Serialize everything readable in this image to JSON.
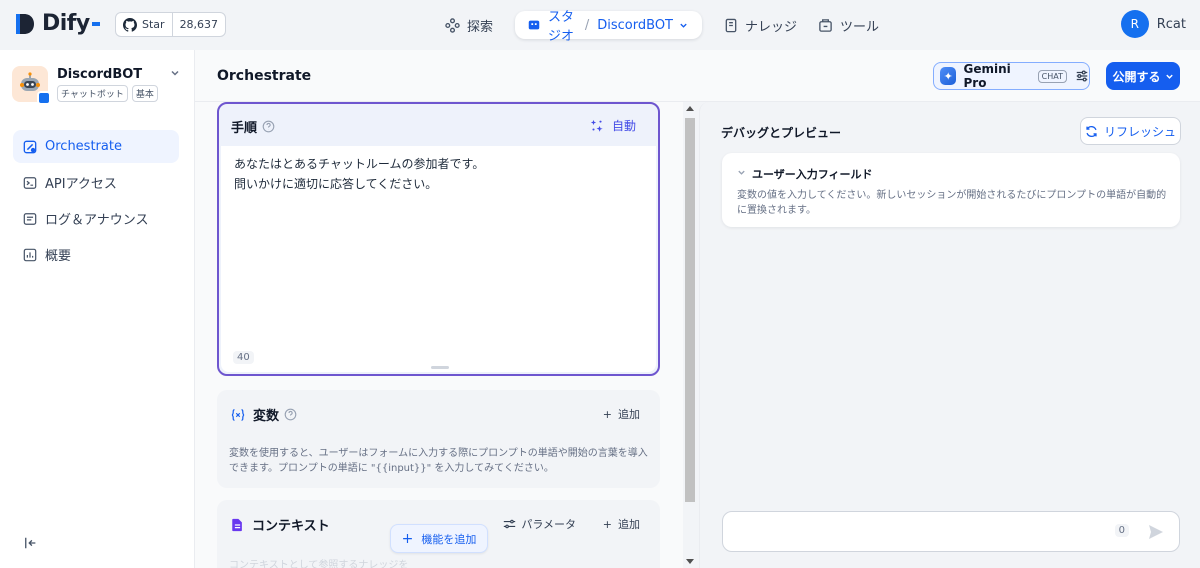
{
  "brand": {
    "name": "Dify"
  },
  "github": {
    "star_label": "Star",
    "count": "28,637"
  },
  "nav": {
    "explore": "探索",
    "studio": "スタジオ",
    "current_app": "DiscordBOT",
    "knowledge": "ナレッジ",
    "tools": "ツール"
  },
  "user": {
    "initial": "R",
    "name": "Rcat"
  },
  "app": {
    "name": "DiscordBOT",
    "tags": [
      "チャットボット",
      "基本"
    ]
  },
  "sidebar": {
    "items": [
      {
        "label": "Orchestrate",
        "active": true,
        "icon": "orchestrate-icon"
      },
      {
        "label": "APIアクセス",
        "active": false,
        "icon": "terminal-icon"
      },
      {
        "label": "ログ＆アナウンス",
        "active": false,
        "icon": "log-icon"
      },
      {
        "label": "概要",
        "active": false,
        "icon": "chart-icon"
      }
    ]
  },
  "header": {
    "title": "Orchestrate",
    "model": {
      "name": "Gemini Pro",
      "mode": "CHAT"
    },
    "publish": "公開する"
  },
  "prompt": {
    "title": "手順",
    "auto": "自動",
    "text_line1": "あなたはとあるチャットルームの参加者です。",
    "text_line2": "問いかけに適切に応答してください。",
    "count": "40"
  },
  "variables": {
    "title": "変数",
    "add": "追加",
    "desc": "変数を使用すると、ユーザーはフォームに入力する際にプロンプトの単語や開始の言葉を導入できます。プロンプトの単語に \"{{input}}\" を入力してみてください。"
  },
  "context": {
    "title": "コンテキスト",
    "params": "パラメータ",
    "add": "追加",
    "faded": "コンテキストとして参照するナレッジを"
  },
  "add_feature": "機能を追加",
  "debug": {
    "title": "デバッグとプレビュー",
    "refresh": "リフレッシュ",
    "user_input_title": "ユーザー入力フィールド",
    "user_input_desc": "変数の値を入力してください。新しいセッションが開始されるたびにプロンプトの単語が自動的に置換されます。",
    "chat_count": "0"
  },
  "colors": {
    "accent": "#155eef",
    "prompt_border": "#6e56cf"
  }
}
